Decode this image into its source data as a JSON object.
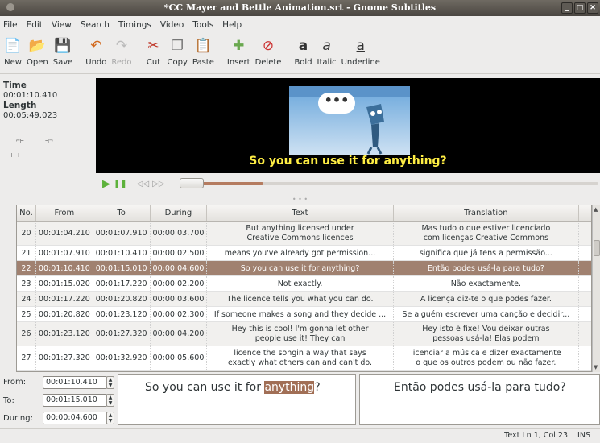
{
  "window": {
    "title": "*CC Mayer and Bettle Animation.srt - Gnome Subtitles",
    "controls": [
      "_",
      "□",
      "✕"
    ]
  },
  "menu": [
    "File",
    "Edit",
    "View",
    "Search",
    "Timings",
    "Video",
    "Tools",
    "Help"
  ],
  "toolbar": [
    {
      "label": "New",
      "icon": "new-document-icon",
      "glyph": "📄",
      "color": "#6aa84f",
      "enabled": true
    },
    {
      "label": "Open",
      "icon": "open-folder-icon",
      "glyph": "📂",
      "color": "#e69138",
      "enabled": true
    },
    {
      "label": "Save",
      "icon": "save-icon",
      "glyph": "💾",
      "color": "#5b8f3e",
      "enabled": true
    },
    {
      "label": "Undo",
      "icon": "undo-icon",
      "glyph": "↶",
      "color": "#d2691e",
      "enabled": true
    },
    {
      "label": "Redo",
      "icon": "redo-icon",
      "glyph": "↷",
      "color": "#bbbbbb",
      "enabled": false
    },
    {
      "label": "Cut",
      "icon": "cut-icon",
      "glyph": "✂",
      "color": "#c0392b",
      "enabled": true
    },
    {
      "label": "Copy",
      "icon": "copy-icon",
      "glyph": "❐",
      "color": "#777777",
      "enabled": true
    },
    {
      "label": "Paste",
      "icon": "paste-icon",
      "glyph": "📋",
      "color": "#8d6e63",
      "enabled": true
    },
    {
      "label": "Insert",
      "icon": "insert-plus-icon",
      "glyph": "✚",
      "color": "#6aa84f",
      "enabled": true
    },
    {
      "label": "Delete",
      "icon": "delete-icon",
      "glyph": "⊘",
      "color": "#cc3333",
      "enabled": true
    },
    {
      "label": "Bold",
      "icon": "bold-icon",
      "glyph": "a",
      "color": "#333333",
      "enabled": true
    },
    {
      "label": "Italic",
      "icon": "italic-icon",
      "glyph": "a",
      "color": "#333333",
      "enabled": true
    },
    {
      "label": "Underline",
      "icon": "underline-icon",
      "glyph": "a",
      "color": "#333333",
      "enabled": true
    }
  ],
  "side": {
    "time_label": "Time",
    "time_value": "00:01:10.410",
    "length_label": "Length",
    "length_value": "00:05:49.023"
  },
  "video": {
    "subtitle": "So you can use it for anything?",
    "seek_fraction": 0.2
  },
  "grid": {
    "headers": [
      "No.",
      "From",
      "To",
      "During",
      "Text",
      "Translation"
    ],
    "rows": [
      {
        "no": "20",
        "from": "00:01:04.210",
        "to": "00:01:07.910",
        "during": "00:00:03.700",
        "text": "But anything licensed under\nCreative Commons licences",
        "translation": "Mas tudo o que estiver licenciado\ncom licenças Creative Commons",
        "state": "alt"
      },
      {
        "no": "21",
        "from": "00:01:07.910",
        "to": "00:01:10.410",
        "during": "00:00:02.500",
        "text": "means you've already got permission...",
        "translation": "significa que já tens a permissão...",
        "state": ""
      },
      {
        "no": "22",
        "from": "00:01:10.410",
        "to": "00:01:15.010",
        "during": "00:00:04.600",
        "text": "So you can use it for anything?",
        "translation": "Então podes usá-la para tudo?",
        "state": "sel"
      },
      {
        "no": "23",
        "from": "00:01:15.020",
        "to": "00:01:17.220",
        "during": "00:00:02.200",
        "text": "Not exactly.",
        "translation": "Não exactamente.",
        "state": ""
      },
      {
        "no": "24",
        "from": "00:01:17.220",
        "to": "00:01:20.820",
        "during": "00:00:03.600",
        "text": "The licence tells you what you can do.",
        "translation": "A licença diz-te o que podes fazer.",
        "state": "alt"
      },
      {
        "no": "25",
        "from": "00:01:20.820",
        "to": "00:01:23.120",
        "during": "00:00:02.300",
        "text": "If someone makes a song and they decide ...",
        "translation": "Se alguém escrever uma canção e decidir...",
        "state": ""
      },
      {
        "no": "26",
        "from": "00:01:23.120",
        "to": "00:01:27.320",
        "during": "00:00:04.200",
        "text": "Hey this is cool! I'm gonna let other\npeople use it! They can",
        "translation": "Hey isto é fixe! Vou deixar outras\npessoas usá-la! Elas podem",
        "state": "alt"
      },
      {
        "no": "27",
        "from": "00:01:27.320",
        "to": "00:01:32.920",
        "during": "00:00:05.600",
        "text": "licence the songin a way that says\nexactly what others can and can't do.",
        "translation": "licenciar a música e dizer exactamente\no que os outros podem ou não fazer.",
        "state": ""
      }
    ]
  },
  "editor": {
    "from_label": "From:",
    "from_value": "00:01:10.410",
    "to_label": "To:",
    "to_value": "00:01:15.010",
    "during_label": "During:",
    "during_value": "00:00:04.600",
    "text_before": "So you can use it for ",
    "text_highlight": "anything",
    "text_after": "?",
    "translation": "Então podes usá-la para tudo?"
  },
  "status": {
    "text": "Text Ln 1, Col 23",
    "mode": "INS"
  }
}
